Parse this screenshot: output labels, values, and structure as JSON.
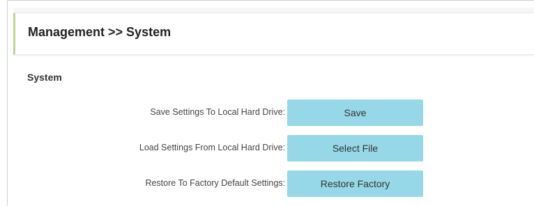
{
  "header": {
    "title": "Management >> System"
  },
  "section": {
    "title": "System"
  },
  "rows": [
    {
      "label": "Save Settings To Local Hard Drive:",
      "button": "Save"
    },
    {
      "label": "Load Settings From Local Hard Drive:",
      "button": "Select File"
    },
    {
      "label": "Restore To Factory Default Settings:",
      "button": "Restore Factory"
    }
  ],
  "colors": {
    "accent_border": "#b7d98b",
    "button_bg": "#96d8e8"
  }
}
